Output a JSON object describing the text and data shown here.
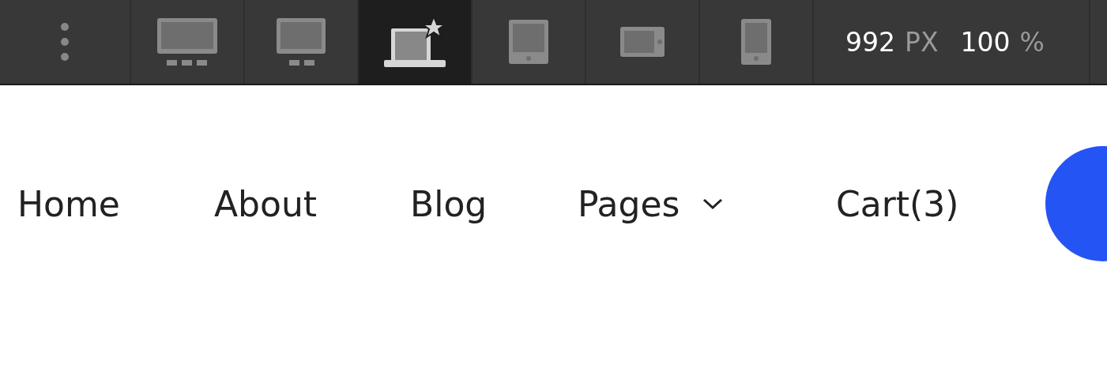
{
  "toolbar": {
    "devices": [
      {
        "kind": "desktop-large",
        "selected": false
      },
      {
        "kind": "desktop",
        "selected": false
      },
      {
        "kind": "laptop",
        "selected": true
      },
      {
        "kind": "tablet",
        "selected": false
      },
      {
        "kind": "tablet-landscape",
        "selected": false
      },
      {
        "kind": "phone",
        "selected": false
      }
    ],
    "width": {
      "value": "992",
      "unit": "PX"
    },
    "zoom": {
      "value": "100",
      "unit": "%"
    }
  },
  "nav": {
    "items": [
      {
        "label": "Home",
        "dropdown": false
      },
      {
        "label": "About",
        "dropdown": false
      },
      {
        "label": "Blog",
        "dropdown": false
      },
      {
        "label": "Pages",
        "dropdown": true
      },
      {
        "label": "Cart(3)",
        "dropdown": false
      }
    ]
  }
}
